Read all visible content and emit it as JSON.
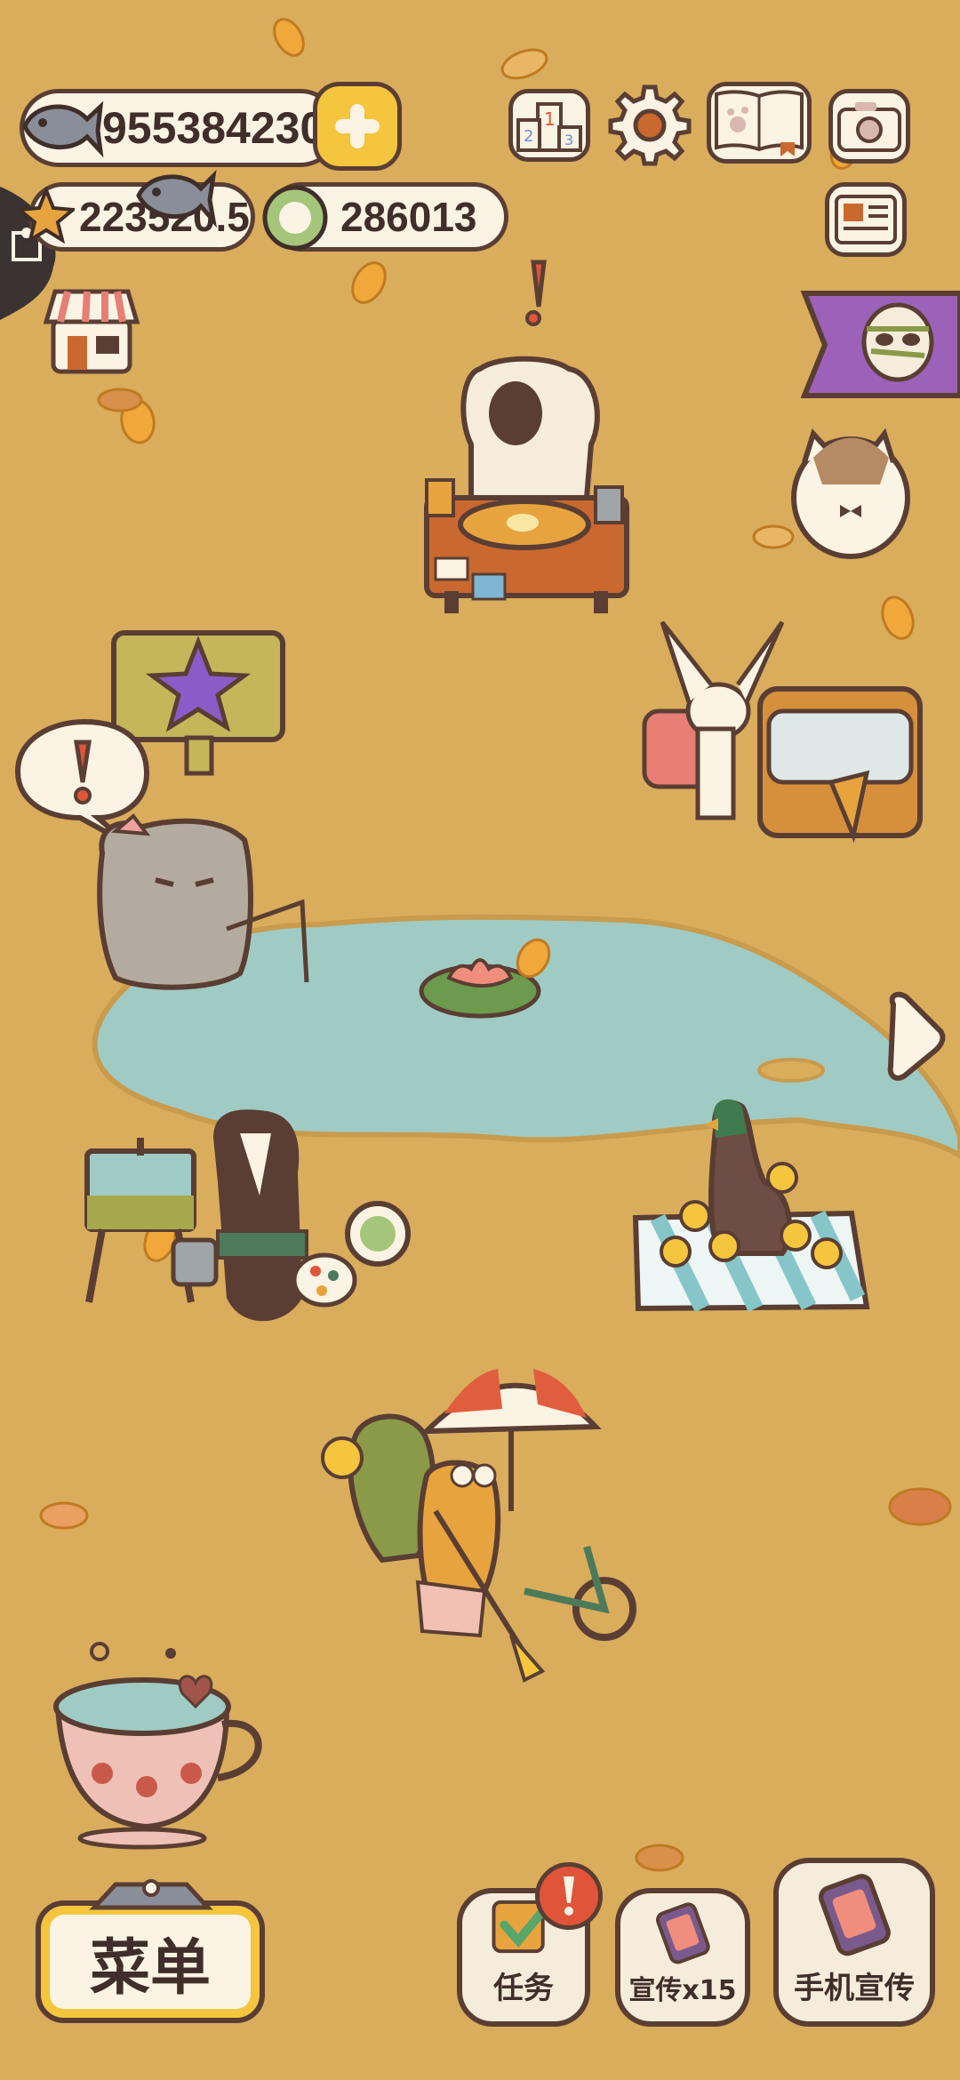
{
  "currencies": {
    "fish": "955384230",
    "stars": "223520.5",
    "coins": "286013"
  },
  "buttons": {
    "menu": "菜单",
    "tasks": "任务",
    "promote": "宣传x15",
    "phone_promote": "手机宣传"
  },
  "colors": {
    "background": "#d9ad5c",
    "pond": "#9fcbc4",
    "outline": "#5a3e33",
    "panel": "#fbf3e3",
    "accent_yellow": "#f5c53d",
    "alert_red": "#e0553a",
    "banner_purple": "#9c62b9"
  }
}
